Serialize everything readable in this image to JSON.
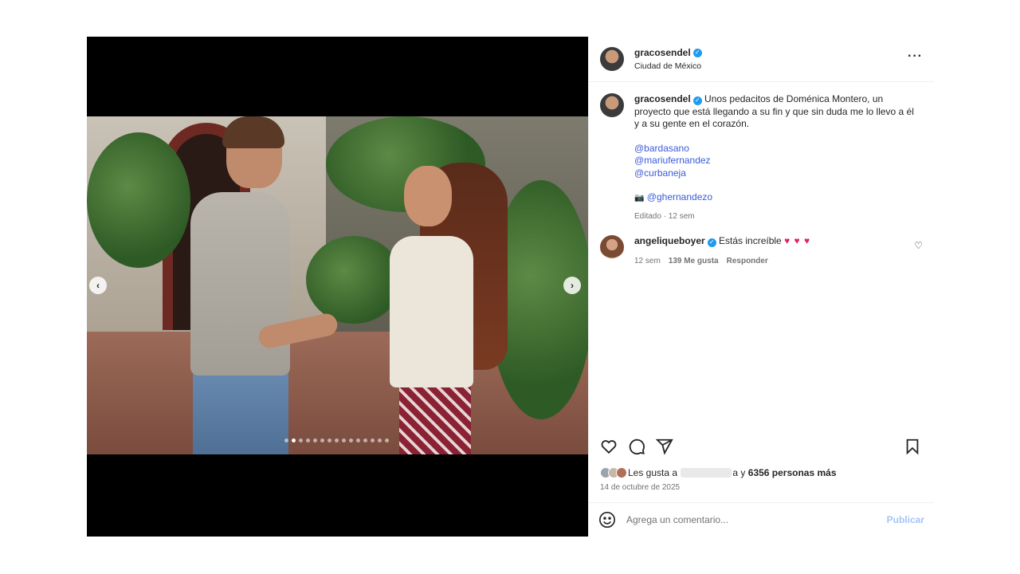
{
  "post": {
    "username": "gracosendel",
    "location": "Ciudad de México",
    "caption": "Unos pedacitos de Doménica Montero, un proyecto que está llegando a su fin y que sin duda me lo llevo a él y a su gente en el corazón.",
    "mentions": [
      "@bardasano",
      "@mariufernandez",
      "@curbaneja"
    ],
    "camera_prefix": "📷",
    "photo_credit": "@ghernandezo",
    "edited_meta": "Editado · 12 sem"
  },
  "carousel": {
    "prev_label": "‹",
    "next_label": "›",
    "total_slides": 15,
    "active_slide": 2
  },
  "comment": {
    "username": "angeliqueboyer",
    "text": "Estás increíble",
    "hearts": "♥ ♥ ♥",
    "time": "12 sem",
    "likes": "139 Me gusta",
    "reply": "Responder"
  },
  "likes": {
    "prefix": "Les gusta a",
    "suffix_letter": "a",
    "joiner": "y",
    "others": "6356 personas más"
  },
  "date": "14 de octubre de 2025",
  "composer": {
    "placeholder": "Agrega un comentario...",
    "publish": "Publicar"
  },
  "icons": {
    "more": "···",
    "verified": "✓",
    "small_heart": "♡"
  }
}
